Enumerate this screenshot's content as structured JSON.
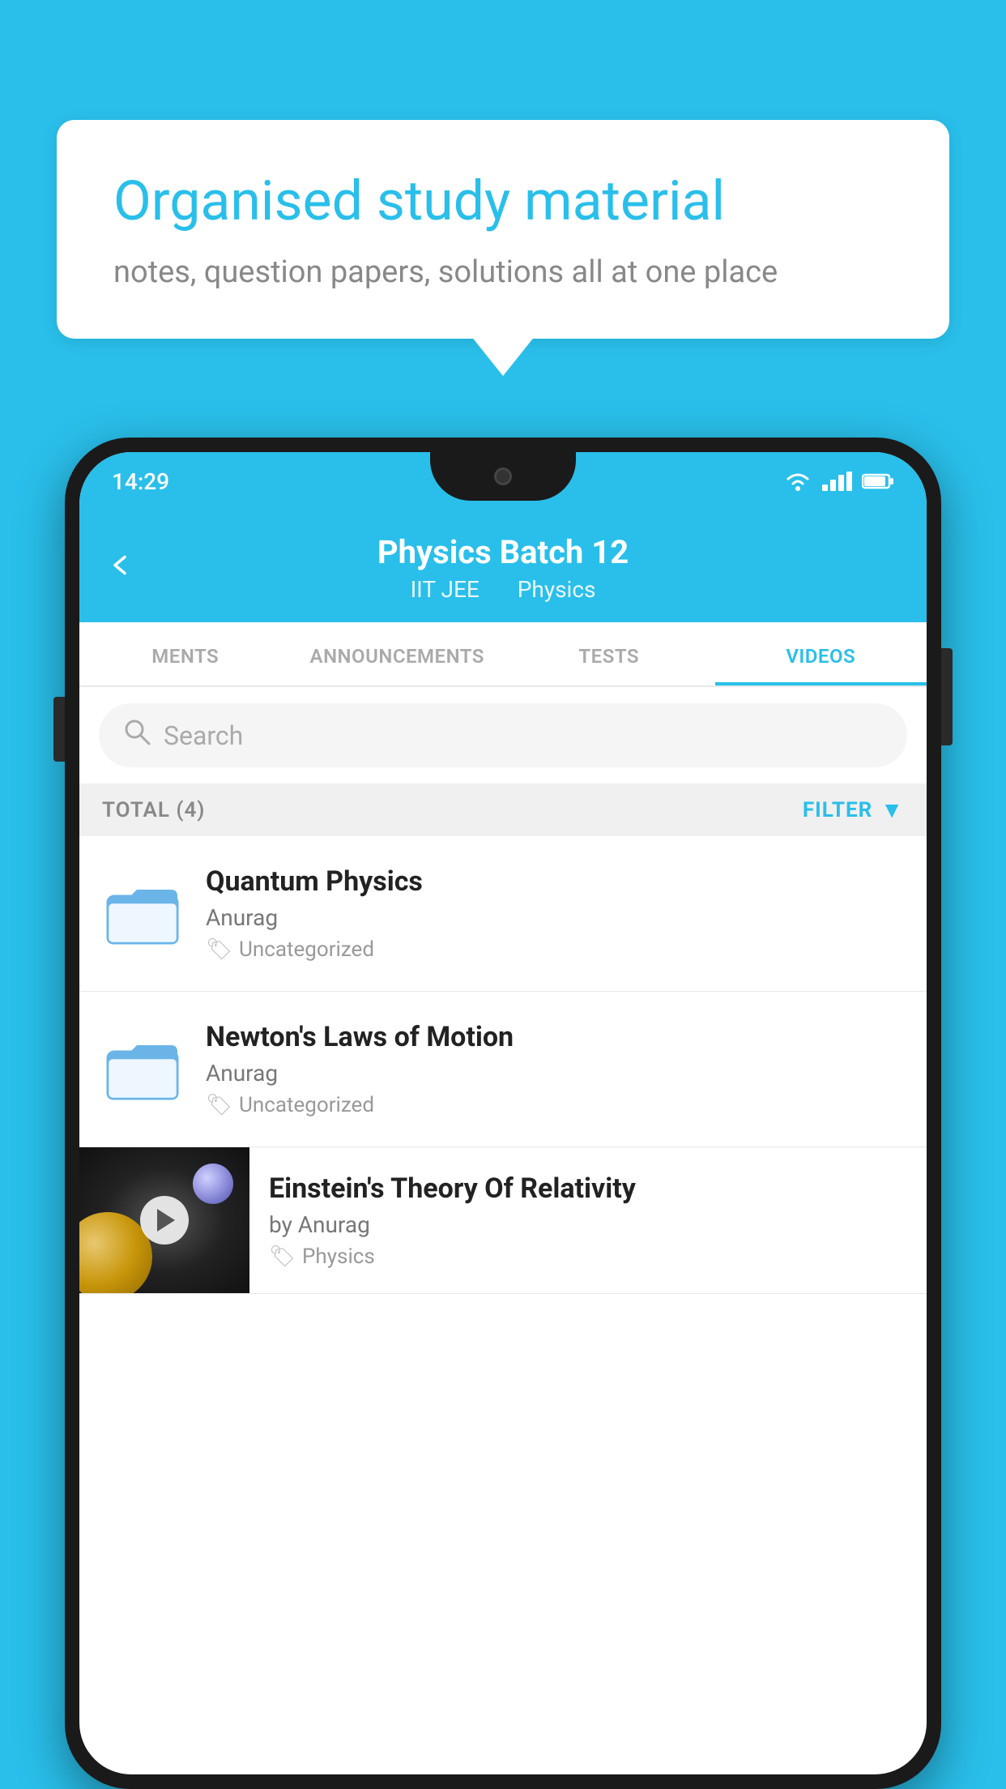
{
  "background_color": "#29BFEA",
  "speech_bubble": {
    "title": "Organised study material",
    "subtitle": "notes, question papers, solutions all at one place"
  },
  "phone": {
    "status_bar": {
      "time": "14:29"
    },
    "header": {
      "title": "Physics Batch 12",
      "subtitle_parts": [
        "IIT JEE",
        "Physics"
      ]
    },
    "tabs": [
      {
        "label": "MENTS",
        "active": false
      },
      {
        "label": "ANNOUNCEMENTS",
        "active": false
      },
      {
        "label": "TESTS",
        "active": false
      },
      {
        "label": "VIDEOS",
        "active": true
      }
    ],
    "search": {
      "placeholder": "Search"
    },
    "filter": {
      "total_label": "TOTAL (4)",
      "filter_label": "FILTER"
    },
    "videos": [
      {
        "id": 1,
        "title": "Quantum Physics",
        "author": "Anurag",
        "tag": "Uncategorized",
        "type": "folder"
      },
      {
        "id": 2,
        "title": "Newton's Laws of Motion",
        "author": "Anurag",
        "tag": "Uncategorized",
        "type": "folder"
      },
      {
        "id": 3,
        "title": "Einstein's Theory Of Relativity",
        "author": "by Anurag",
        "tag": "Physics",
        "type": "video"
      }
    ]
  }
}
